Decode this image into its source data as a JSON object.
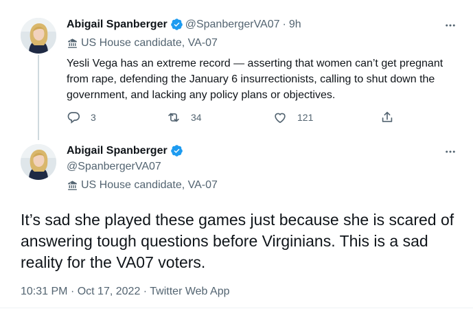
{
  "colors": {
    "verified": "#1d9bf0",
    "secondary_text": "#536471",
    "primary_text": "#0f1419"
  },
  "parent_tweet": {
    "name": "Abigail Spanberger",
    "handle": "@SpanbergerVA07",
    "separator": "·",
    "time": "9h",
    "label": "US House candidate, VA-07",
    "text": "Yesli Vega has an extreme record — asserting that women can’t get pregnant from rape, defending the January 6 insurrectionists, calling to shut down the government, and lacking any policy plans or objectives.",
    "more_icon": "more-horizontal-icon",
    "actions": {
      "replies": "3",
      "retweets": "34",
      "likes": "121"
    }
  },
  "main_tweet": {
    "name": "Abigail Spanberger",
    "handle": "@SpanbergerVA07",
    "label": "US House candidate, VA-07",
    "text": "It’s sad she played these games just because she is scared of answering tough questions before Virginians. This is a sad reality for the VA07 voters.",
    "meta": {
      "time": "10:31 PM",
      "separator1": "·",
      "date": "Oct 17, 2022",
      "separator2": "·",
      "source": "Twitter Web App"
    }
  }
}
